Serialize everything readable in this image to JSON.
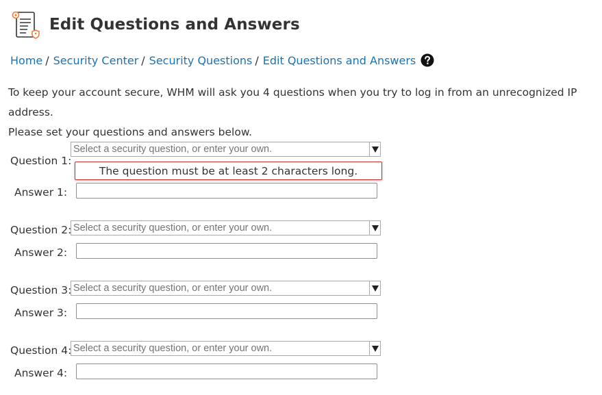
{
  "header": {
    "title": "Edit Questions and Answers",
    "icon": "security-questions-document-icon",
    "icon_accent_color": "#f47a37"
  },
  "breadcrumb": {
    "items": [
      "Home",
      "Security Center",
      "Security Questions",
      "Edit Questions and Answers"
    ],
    "separator": "/",
    "link_color": "#1b72b5",
    "help_icon": "question-circle-icon"
  },
  "intro": {
    "line1": "To keep your account secure, WHM will ask you 4 questions when you try to log in from an unrecognized IP address.",
    "line2": "Please set your questions and answers below."
  },
  "questions": [
    {
      "question_label": "Question 1:",
      "question_placeholder": "Select a security question, or enter your own.",
      "question_value": "",
      "answer_label": "Answer 1:",
      "answer_value": "",
      "error": "The question must be at least 2 characters long."
    },
    {
      "question_label": "Question 2:",
      "question_placeholder": "Select a security question, or enter your own.",
      "question_value": "",
      "answer_label": "Answer 2:",
      "answer_value": ""
    },
    {
      "question_label": "Question 3:",
      "question_placeholder": "Select a security question, or enter your own.",
      "question_value": "",
      "answer_label": "Answer 3:",
      "answer_value": ""
    },
    {
      "question_label": "Question 4:",
      "question_placeholder": "Select a security question, or enter your own.",
      "question_value": "",
      "answer_label": "Answer 4:",
      "answer_value": ""
    }
  ],
  "colors": {
    "error_border": "#c9302c",
    "text": "#333333"
  }
}
